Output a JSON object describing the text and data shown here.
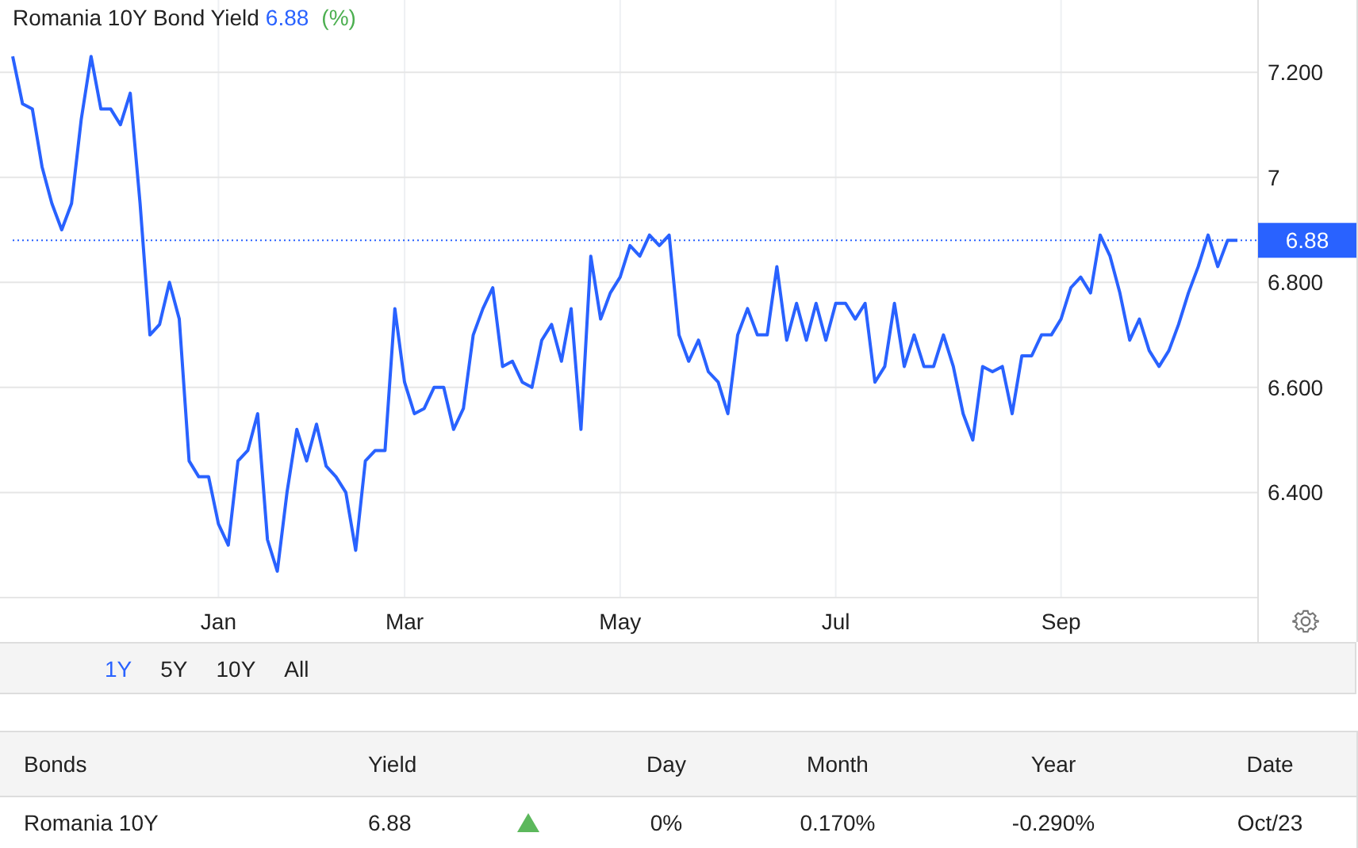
{
  "chart": {
    "current_value": "6.88",
    "unit": "(%)",
    "price_label": "6.88",
    "chart_data": {
      "type": "line",
      "title": "Romania 10Y Bond Yield",
      "categories": [
        null,
        null,
        null,
        null,
        null,
        null,
        null,
        null,
        null,
        null,
        null,
        null,
        null,
        null,
        null,
        null,
        null,
        null,
        null,
        null,
        null,
        "Jan",
        null,
        null,
        null,
        null,
        null,
        null,
        null,
        null,
        null,
        null,
        null,
        null,
        null,
        null,
        null,
        null,
        null,
        null,
        "Mar",
        null,
        null,
        null,
        null,
        null,
        null,
        null,
        null,
        null,
        null,
        null,
        null,
        null,
        null,
        null,
        null,
        null,
        null,
        null,
        null,
        null,
        "May",
        null,
        null,
        null,
        null,
        null,
        null,
        null,
        null,
        null,
        null,
        null,
        null,
        null,
        null,
        null,
        null,
        null,
        null,
        null,
        null,
        null,
        "Jul",
        null,
        null,
        null,
        null,
        null,
        null,
        null,
        null,
        null,
        null,
        null,
        null,
        null,
        null,
        null,
        null,
        null,
        null,
        null,
        null,
        null,
        null,
        "Sep",
        null,
        null,
        null,
        null,
        null,
        null,
        null,
        null,
        null,
        null,
        null,
        null,
        null,
        null,
        null,
        null,
        null,
        null
      ],
      "series": [
        {
          "color": "#2962ff",
          "values": [
            7.23,
            7.14,
            7.13,
            7.02,
            6.95,
            6.9,
            6.95,
            7.11,
            7.23,
            7.13,
            7.13,
            7.1,
            7.16,
            6.95,
            6.7,
            6.72,
            6.8,
            6.73,
            6.46,
            6.43,
            6.43,
            6.34,
            6.3,
            6.46,
            6.48,
            6.55,
            6.31,
            6.25,
            6.4,
            6.52,
            6.46,
            6.53,
            6.45,
            6.43,
            6.4,
            6.29,
            6.46,
            6.48,
            6.48,
            6.75,
            6.61,
            6.55,
            6.56,
            6.6,
            6.6,
            6.52,
            6.56,
            6.7,
            6.75,
            6.79,
            6.64,
            6.65,
            6.61,
            6.6,
            6.69,
            6.72,
            6.65,
            6.75,
            6.52,
            6.85,
            6.73,
            6.78,
            6.81,
            6.87,
            6.85,
            6.89,
            6.87,
            6.89,
            6.7,
            6.65,
            6.69,
            6.63,
            6.61,
            6.55,
            6.7,
            6.75,
            6.7,
            6.7,
            6.83,
            6.69,
            6.76,
            6.69,
            6.76,
            6.69,
            6.76,
            6.76,
            6.73,
            6.76,
            6.61,
            6.64,
            6.76,
            6.64,
            6.7,
            6.64,
            6.64,
            6.7,
            6.64,
            6.55,
            6.5,
            6.64,
            6.63,
            6.64,
            6.55,
            6.66,
            6.66,
            6.7,
            6.7,
            6.73,
            6.79,
            6.81,
            6.78,
            6.89,
            6.85,
            6.78,
            6.69,
            6.73,
            6.67,
            6.64,
            6.67,
            6.72,
            6.78,
            6.83,
            6.89,
            6.83,
            6.88,
            6.88
          ]
        }
      ],
      "ylim": [
        6.2,
        7.3375
      ],
      "grid": true,
      "ref_lines": [
        {
          "axis": "y",
          "value": 6.88,
          "color": "#2962ff"
        }
      ],
      "yticks": [
        {
          "value": 7.2,
          "label": "7.200"
        },
        {
          "value": 7,
          "label": "7"
        },
        {
          "value": 6.8,
          "label": "6.800"
        },
        {
          "value": 6.6,
          "label": "6.600"
        },
        {
          "value": 6.4,
          "label": "6.400"
        }
      ]
    }
  },
  "ranges": [
    {
      "label": "1Y",
      "selected": true
    },
    {
      "label": "5Y",
      "selected": false
    },
    {
      "label": "10Y",
      "selected": false
    },
    {
      "label": "All",
      "selected": false
    }
  ],
  "table": {
    "columns": [
      "Bonds",
      "Yield",
      "Day",
      "Month",
      "Year",
      "Date"
    ],
    "rows": [
      {
        "bond": "Romania 10Y",
        "yield": "6.88",
        "rising": true,
        "day": "0%",
        "month": "0.170%",
        "year": "-0.290%",
        "date": "Oct/23"
      }
    ]
  }
}
